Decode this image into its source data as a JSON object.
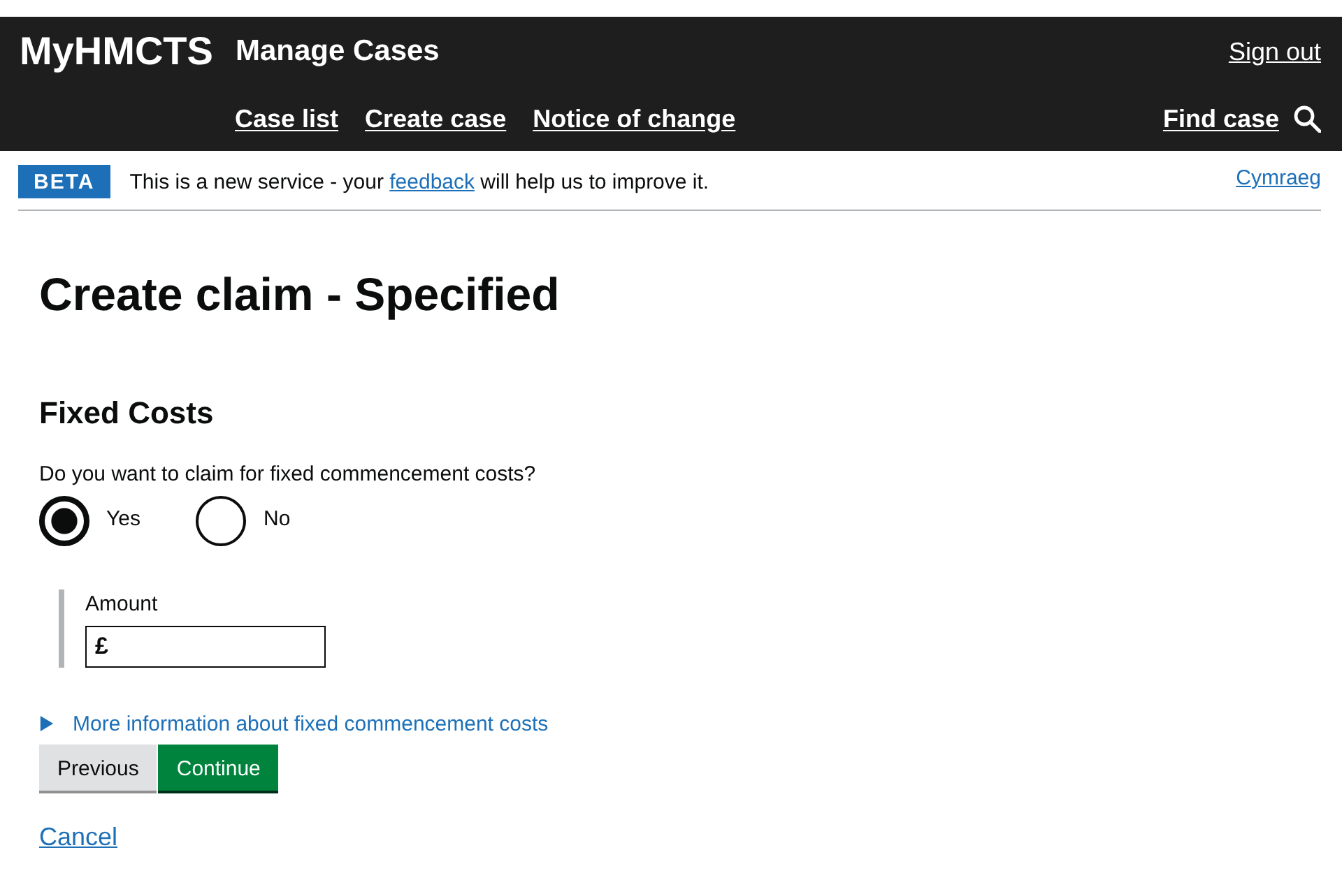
{
  "header": {
    "logo": "MyHMCTS",
    "service_name": "Manage Cases",
    "sign_out": "Sign out",
    "nav": [
      {
        "label": "Case list"
      },
      {
        "label": "Create case"
      },
      {
        "label": "Notice of change"
      }
    ],
    "find_case": "Find case"
  },
  "phase_banner": {
    "tag": "BETA",
    "text_before": "This is a new service - your ",
    "link": "feedback",
    "text_after": " will help us to improve it.",
    "language_link": "Cymraeg"
  },
  "page_title": "Create claim - Specified",
  "section_title": "Fixed Costs",
  "question": {
    "label": "Do you want to claim for fixed commencement costs?",
    "options": [
      {
        "label": "Yes",
        "selected": true
      },
      {
        "label": "No",
        "selected": false
      }
    ]
  },
  "conditional": {
    "label": "Amount",
    "prefix": "£"
  },
  "details": {
    "summary": "More information about fixed commencement costs",
    "expanded": false
  },
  "buttons": [
    {
      "label": "Previous",
      "kind": "secondary"
    },
    {
      "label": "Continue",
      "kind": "primary"
    }
  ],
  "cancel": "Cancel"
}
